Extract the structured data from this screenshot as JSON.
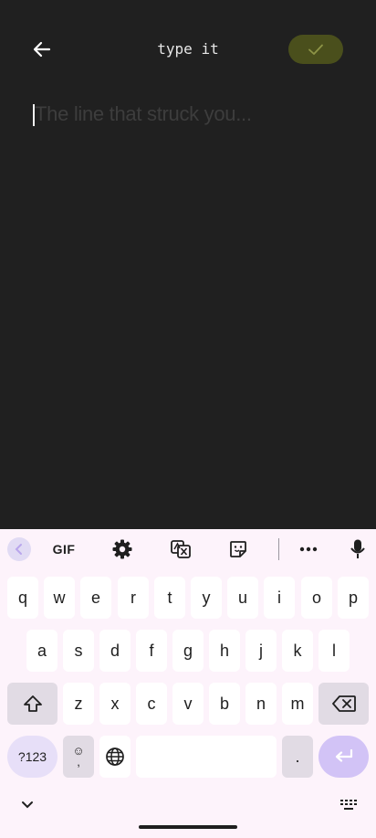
{
  "app": {
    "title": "type it",
    "placeholder": "The line that struck you...",
    "back_icon": "arrow-left-icon",
    "confirm_icon": "check-icon",
    "colors": {
      "background": "#202020",
      "confirm_button": "#4a4f1c",
      "placeholder": "#3d3d3d"
    }
  },
  "keyboard": {
    "toolbar": {
      "collapse_icon": "chevron-left-icon",
      "gif_label": "GIF",
      "settings_icon": "gear-icon",
      "translate_icon": "translate-icon",
      "sticker_icon": "sticker-icon",
      "more_icon": "more-horizontal-icon",
      "mic_icon": "microphone-icon"
    },
    "rows": [
      [
        "q",
        "w",
        "e",
        "r",
        "t",
        "y",
        "u",
        "i",
        "o",
        "p"
      ],
      [
        "a",
        "s",
        "d",
        "f",
        "g",
        "h",
        "j",
        "k",
        "l"
      ],
      [
        "z",
        "x",
        "c",
        "v",
        "b",
        "n",
        "m"
      ]
    ],
    "symbols_label": "?123",
    "emoji_key": {
      "top": "☺",
      "bottom": ","
    },
    "period_label": ".",
    "colors": {
      "background": "#fdf3fb",
      "key": "#ffffff",
      "function_key": "#e1dbe4",
      "enter": "#d2c3f6"
    }
  }
}
